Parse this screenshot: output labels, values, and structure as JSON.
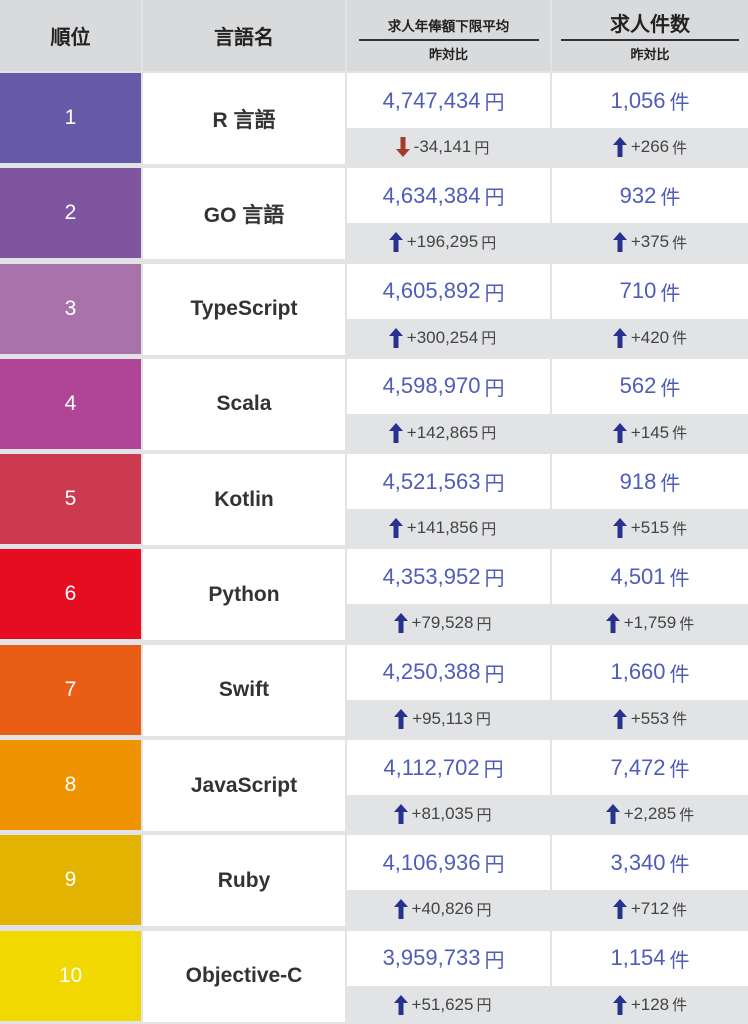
{
  "header": {
    "rank": "順位",
    "language": "言語名",
    "salary_title": "求人年俸額下限平均",
    "salary_sub": "昨対比",
    "count_title": "求人件数",
    "count_sub": "昨対比"
  },
  "units": {
    "yen": "円",
    "ken": "件"
  },
  "colors": {
    "value_text": "#4f5cb8",
    "arrow_up": "#27318f",
    "arrow_down": "#a33a2c"
  },
  "rows": [
    {
      "rank": "1",
      "language": "R 言語",
      "color": "#6659a8",
      "salary": "4,747,434",
      "salary_delta": "-34,141",
      "salary_dir": "down",
      "count": "1,056",
      "count_delta": "+266",
      "count_dir": "up"
    },
    {
      "rank": "2",
      "language": "GO 言語",
      "color": "#7f55a0",
      "salary": "4,634,384",
      "salary_delta": "+196,295",
      "salary_dir": "up",
      "count": "932",
      "count_delta": "+375",
      "count_dir": "up"
    },
    {
      "rank": "3",
      "language": "TypeScript",
      "color": "#a873aa",
      "salary": "4,605,892",
      "salary_delta": "+300,254",
      "salary_dir": "up",
      "count": "710",
      "count_delta": "+420",
      "count_dir": "up"
    },
    {
      "rank": "4",
      "language": "Scala",
      "color": "#b04598",
      "salary": "4,598,970",
      "salary_delta": "+142,865",
      "salary_dir": "up",
      "count": "562",
      "count_delta": "+145",
      "count_dir": "up"
    },
    {
      "rank": "5",
      "language": "Kotlin",
      "color": "#cc3a4f",
      "salary": "4,521,563",
      "salary_delta": "+141,856",
      "salary_dir": "up",
      "count": "918",
      "count_delta": "+515",
      "count_dir": "up"
    },
    {
      "rank": "6",
      "language": "Python",
      "color": "#e60d21",
      "salary": "4,353,952",
      "salary_delta": "+79,528",
      "salary_dir": "up",
      "count": "4,501",
      "count_delta": "+1,759",
      "count_dir": "up"
    },
    {
      "rank": "7",
      "language": "Swift",
      "color": "#e95d16",
      "salary": "4,250,388",
      "salary_delta": "+95,113",
      "salary_dir": "up",
      "count": "1,660",
      "count_delta": "+553",
      "count_dir": "up"
    },
    {
      "rank": "8",
      "language": "JavaScript",
      "color": "#f09300",
      "salary": "4,112,702",
      "salary_delta": "+81,035",
      "salary_dir": "up",
      "count": "7,472",
      "count_delta": "+2,285",
      "count_dir": "up"
    },
    {
      "rank": "9",
      "language": "Ruby",
      "color": "#e2b300",
      "salary": "4,106,936",
      "salary_delta": "+40,826",
      "salary_dir": "up",
      "count": "3,340",
      "count_delta": "+712",
      "count_dir": "up"
    },
    {
      "rank": "10",
      "language": "Objective-C",
      "color": "#f0d800",
      "salary": "3,959,733",
      "salary_delta": "+51,625",
      "salary_dir": "up",
      "count": "1,154",
      "count_delta": "+128",
      "count_dir": "up"
    }
  ]
}
